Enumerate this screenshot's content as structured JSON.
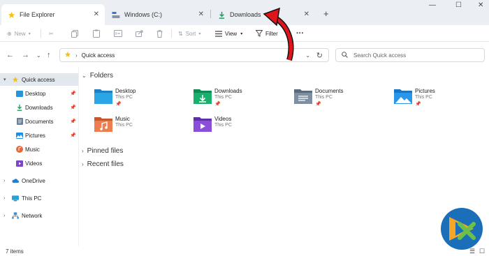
{
  "window": {
    "tabs": [
      {
        "label": "File Explorer",
        "icon": "star-icon",
        "active": true
      },
      {
        "label": "Windows (C:)",
        "icon": "drive-icon",
        "active": false
      },
      {
        "label": "Downloads",
        "icon": "download-icon",
        "active": false
      }
    ],
    "new_tab_glyph": "+",
    "controls": {
      "minimize": "—",
      "maximize": "☐",
      "close": "✕"
    }
  },
  "toolbar": {
    "new_label": "New",
    "sort_label": "Sort",
    "view_label": "View",
    "filter_label": "Filter",
    "more_glyph": "···"
  },
  "address": {
    "location": "Quick access",
    "search_placeholder": "Search Quick access"
  },
  "sidebar": {
    "items": [
      {
        "label": "Quick access",
        "icon": "star-icon"
      },
      {
        "label": "Desktop",
        "icon": "desktop-folder-icon"
      },
      {
        "label": "Downloads",
        "icon": "download-icon"
      },
      {
        "label": "Documents",
        "icon": "documents-icon"
      },
      {
        "label": "Pictures",
        "icon": "pictures-icon"
      },
      {
        "label": "Music",
        "icon": "music-icon"
      },
      {
        "label": "Videos",
        "icon": "videos-icon"
      },
      {
        "label": "OneDrive",
        "icon": "cloud-icon"
      },
      {
        "label": "This PC",
        "icon": "pc-icon"
      },
      {
        "label": "Network",
        "icon": "network-icon"
      }
    ]
  },
  "content": {
    "folders_heading": "Folders",
    "folders": [
      {
        "name": "Desktop",
        "location": "This PC",
        "icon": "desktop-folder-icon"
      },
      {
        "name": "Downloads",
        "location": "This PC",
        "icon": "downloads-folder-icon"
      },
      {
        "name": "Documents",
        "location": "This PC",
        "icon": "documents-folder-icon"
      },
      {
        "name": "Pictures",
        "location": "This PC",
        "icon": "pictures-folder-icon"
      },
      {
        "name": "Music",
        "location": "This PC",
        "icon": "music-folder-icon"
      },
      {
        "name": "Videos",
        "location": "This PC",
        "icon": "videos-folder-icon"
      }
    ],
    "pinned_heading": "Pinned files",
    "recent_heading": "Recent files"
  },
  "status": {
    "items_count": "7 items"
  },
  "colors": {
    "accent": "#0a74c9",
    "annotation_arrow": "#e0151b"
  }
}
